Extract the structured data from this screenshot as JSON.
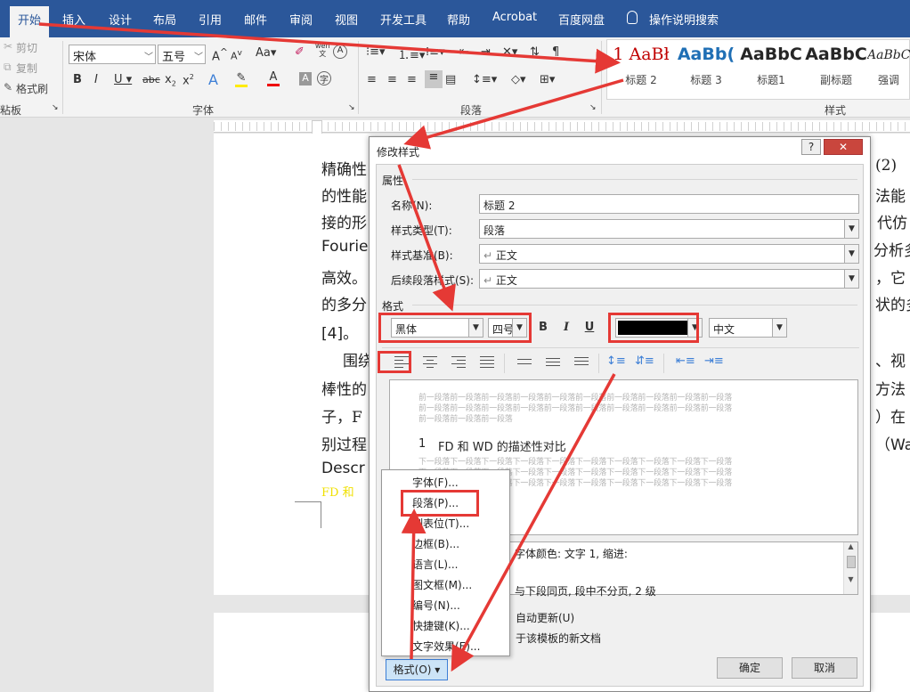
{
  "tabs": [
    {
      "id": "home",
      "label": "开始",
      "active": true
    },
    {
      "id": "insert",
      "label": "插入"
    },
    {
      "id": "design",
      "label": "设计"
    },
    {
      "id": "layout",
      "label": "布局"
    },
    {
      "id": "references",
      "label": "引用"
    },
    {
      "id": "mailings",
      "label": "邮件"
    },
    {
      "id": "review",
      "label": "审阅"
    },
    {
      "id": "view",
      "label": "视图"
    },
    {
      "id": "developer",
      "label": "开发工具"
    },
    {
      "id": "help",
      "label": "帮助"
    },
    {
      "id": "acrobat",
      "label": "Acrobat"
    },
    {
      "id": "baidu",
      "label": "百度网盘"
    }
  ],
  "tell_me": "操作说明搜索",
  "clipboard": {
    "cut": "剪切",
    "copy": "复制",
    "format_painter": "格式刷",
    "group": "粘板"
  },
  "font_group": {
    "font_name": "宋体",
    "font_size": "五号",
    "group": "字体",
    "wen_label": "wén",
    "wen_char": "文"
  },
  "paragraph_group": {
    "group": "段落"
  },
  "styles_group": {
    "group": "样式",
    "items": [
      {
        "sample": "1 AaBł",
        "name": "标题 2",
        "color": "#c00000"
      },
      {
        "sample": "AaBb(",
        "name": "标题 3",
        "color": "#1f6fb5"
      },
      {
        "sample": "AaBbC",
        "name": "标题1",
        "color": "#000000"
      },
      {
        "sample": "AaBbC",
        "name": "副标题",
        "color": "#000000"
      },
      {
        "sample": "AaBbCc",
        "name": "强调",
        "color": "#000000"
      }
    ]
  },
  "document": {
    "left_lines": [
      "精确性",
      "的性能",
      "接的形",
      "Fourie",
      "高效。",
      "的多分",
      "[4]。",
      "围绕",
      "棒性的",
      "子，F",
      "别过程",
      "Descr",
      "FD 和"
    ],
    "right_lines": [
      "(2)",
      "法能",
      "代仿",
      "分析多",
      "，它",
      "状的多",
      "、视",
      "方法",
      "）在",
      "（Wa"
    ]
  },
  "dialog": {
    "title": "修改样式",
    "help": "?",
    "close": "✕",
    "properties_label": "属性",
    "name_label": "名称(N):",
    "name_value": "标题 2",
    "type_label": "样式类型(T):",
    "type_value": "段落",
    "based_on_label": "样式基准(B):",
    "based_on_value": "正文",
    "next_label": "后续段落样式(S):",
    "next_value": "正文",
    "format_label": "格式",
    "font_value": "黑体",
    "size_value": "四号",
    "bold": "B",
    "italic": "I",
    "underline": "U",
    "script_value": "中文",
    "preview_before": [
      "前一段落前一段落前一段落前一段落前一段落前一段落前一段落前一段落前一段落前一段落",
      "前一段落前一段落前一段落前一段落前一段落前一段落前一段落前一段落前一段落前一段落",
      "前一段落前一段落前一段落"
    ],
    "preview_heading_num": "1",
    "preview_heading": "FD 和 WD 的描述性对比",
    "preview_after": [
      "下一段落下一段落下一段落下一段落下一段落下一段落下一段落下一段落下一段落下一段落",
      "下一段落下一段落下一段落下一段落下一段落下一段落下一段落下一段落下一段落下一段落",
      "下一段落下一段落下一段落下一段落下一段落下一段落下一段落下一段落下一段落下一段落"
    ],
    "description_line1": "字体颜色: 文字 1, 缩进:",
    "description_line2": "与下段同页, 段中不分页, 2 级",
    "auto_update": "自动更新(U)",
    "new_docs": "于该模板的新文档",
    "format_button": "格式(O) ▾",
    "ok": "确定",
    "cancel": "取消"
  },
  "format_menu": [
    "字体(F)...",
    "段落(P)...",
    "制表位(T)...",
    "边框(B)...",
    "语言(L)...",
    "图文框(M)...",
    "编号(N)...",
    "快捷键(K)...",
    "文字效果(E)..."
  ]
}
